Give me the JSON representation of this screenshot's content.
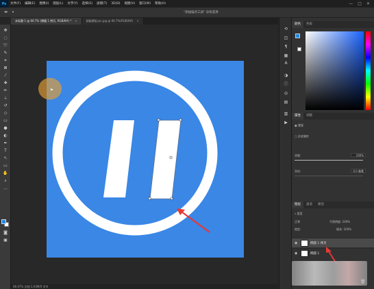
{
  "menubar": {
    "logo": "Ps",
    "items": [
      "文件(F)",
      "编辑(E)",
      "图像(I)",
      "图层(L)",
      "文字(Y)",
      "选择(S)",
      "滤镜(T)",
      "3D(D)",
      "视图(V)",
      "窗口(W)",
      "帮助(H)"
    ],
    "window_controls": [
      "—",
      "□",
      "✕"
    ]
  },
  "options_bar": {
    "status_text": "\"添加描点工具\" 没有选项"
  },
  "tabs": [
    {
      "label": "未标题-1 @ 66.7% (椭圆 1 拷贝, RGB/8#) *",
      "close": "×",
      "active": true
    },
    {
      "label": "超级模板cpc.jpg @ 66.7%(RGB/8#)",
      "close": "×",
      "active": false
    }
  ],
  "status_bar": {
    "text": "66.67%   文档:1.03M/0 字节"
  },
  "canvas": {
    "background_color": "#3a87e6",
    "ring_color": "#ffffff",
    "arrow_color": "#e53935"
  },
  "panels": {
    "color": {
      "tabs": [
        "颜色",
        "色板"
      ],
      "foreground": "#1e88e5",
      "background": "#ffffff"
    },
    "properties": {
      "tabs": [
        "属性",
        "调整"
      ],
      "header": "蒙版",
      "row1": "形状属性",
      "density_label": "浓度:",
      "density_value": "100%",
      "feather_label": "羽化:",
      "feather_value": "0.0 像素",
      "density_fill": 1.0,
      "feather_fill": 0.0
    },
    "layers": {
      "tabs": [
        "图层",
        "通道",
        "路径"
      ],
      "kind_label": "类型",
      "blend_mode": "正常",
      "opacity_label": "不透明度:",
      "opacity_value": "100%",
      "lock_label": "锁定:",
      "fill_label": "填充:",
      "fill_value": "100%",
      "rows": [
        {
          "name": "椭圆 1 拷贝",
          "selected": true
        },
        {
          "name": "椭圆 1",
          "selected": false
        }
      ]
    }
  }
}
